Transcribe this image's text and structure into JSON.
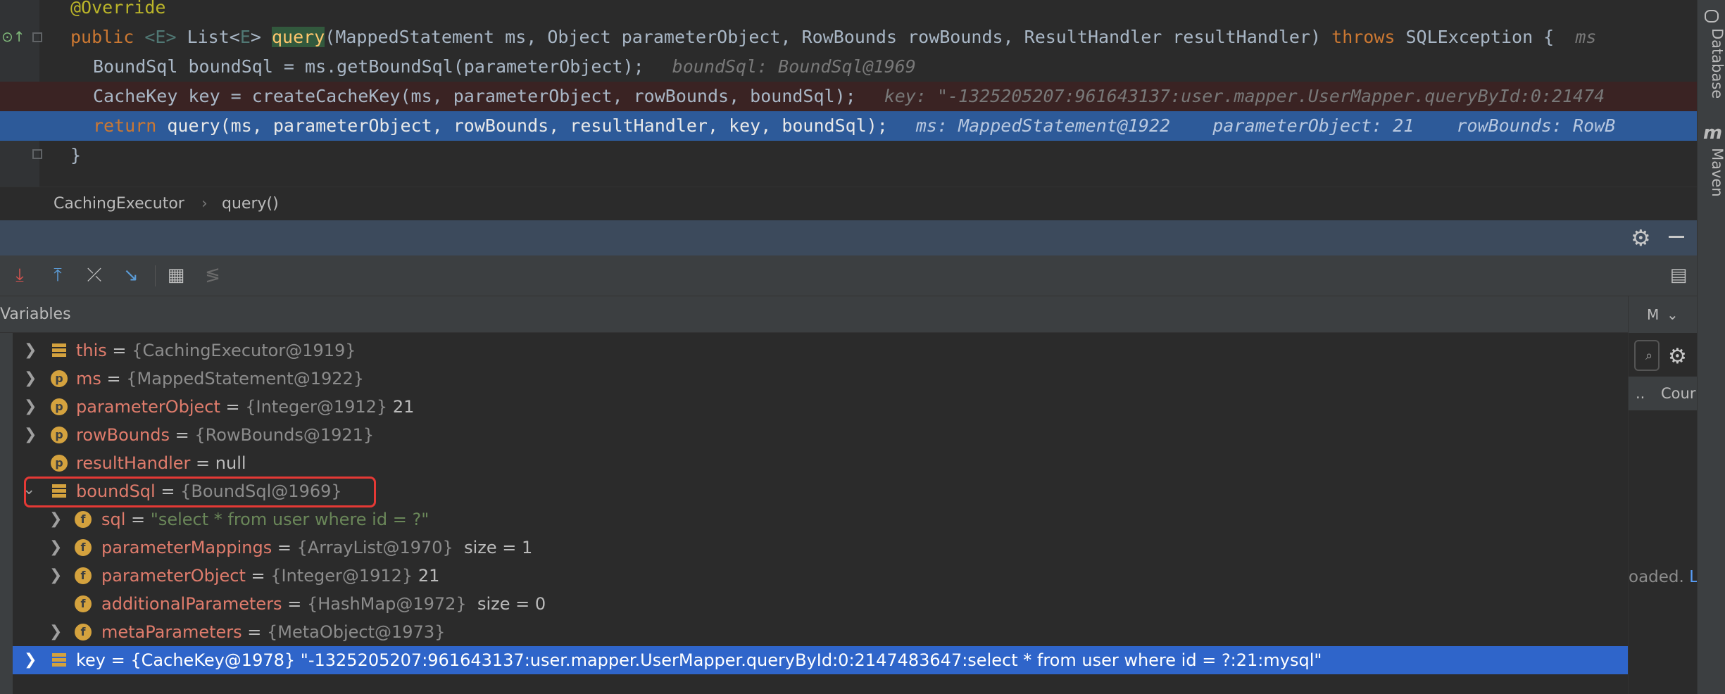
{
  "editor": {
    "line0": {
      "annotation": "@Override"
    },
    "line1": {
      "kw_public": "public ",
      "generic": "<E>",
      "ret_type": " List<",
      "generic2": "E",
      "ret_close": "> ",
      "method": "query",
      "params": "(MappedStatement ms, Object parameterObject, RowBounds rowBounds, ResultHandler resultHandler) ",
      "kw_throws": "throws",
      "rest": " SQLException {  ",
      "hint": "ms"
    },
    "line2": {
      "code": "BoundSql boundSql = ms.getBoundSql(parameterObject);",
      "hint": "boundSql: BoundSql@1969"
    },
    "line3": {
      "code": "CacheKey key = createCacheKey(ms, parameterObject, rowBounds, boundSql);",
      "hint": "key: \"-1325205207:961643137:user.mapper.UserMapper.queryById:0:21474"
    },
    "line4": {
      "kw_return": "return ",
      "code": "query(ms, parameterObject, rowBounds, resultHandler, key, boundSql);",
      "hint": "ms: MappedStatement@1922    parameterObject: 21    rowBounds: RowB"
    },
    "line5": {
      "code": "}"
    }
  },
  "breadcrumb": {
    "class_name": "CachingExecutor",
    "separator": "›",
    "method_name": "query()"
  },
  "right_strip": {
    "tab1": "Database",
    "tab2_icon": "m",
    "tab2": "Maven"
  },
  "debug": {
    "variables_title": "Variables",
    "side_tab": "M",
    "side_label": "Cour",
    "side_status": "oaded.",
    "side_status_link": "L"
  },
  "variables": [
    {
      "name": "this",
      "type": "{CachingExecutor@1919}",
      "value": ""
    },
    {
      "name": "ms",
      "type": "{MappedStatement@1922}",
      "value": ""
    },
    {
      "name": "parameterObject",
      "type": "{Integer@1912}",
      "value": "21"
    },
    {
      "name": "rowBounds",
      "type": "{RowBounds@1921}",
      "value": ""
    },
    {
      "name": "resultHandler",
      "type": "",
      "value": "null"
    },
    {
      "name": "boundSql",
      "type": "{BoundSql@1969}",
      "value": ""
    },
    {
      "name": "sql",
      "type": "",
      "value": "\"select * from user where id = ?\""
    },
    {
      "name": "parameterMappings",
      "type": "{ArrayList@1970}",
      "value": "size = 1"
    },
    {
      "name": "parameterObject",
      "type": "{Integer@1912}",
      "value": "21"
    },
    {
      "name": "additionalParameters",
      "type": "{HashMap@1972}",
      "value": "size = 0"
    },
    {
      "name": "metaParameters",
      "type": "{MetaObject@1973}",
      "value": ""
    },
    {
      "name": "key",
      "type": "{CacheKey@1978}",
      "value": "\"-1325205207:961643137:user.mapper.UserMapper.queryById:0:2147483647:select * from user where id = ?:21:mysql\""
    }
  ],
  "symbols": {
    "eq": " = ",
    "icon_p": "p",
    "icon_f": "f"
  },
  "colors": {
    "accent_selection": "#2f65ca",
    "highlight_box": "#e53935",
    "field_name": "#e07c6c",
    "string_value": "#6a8759"
  }
}
